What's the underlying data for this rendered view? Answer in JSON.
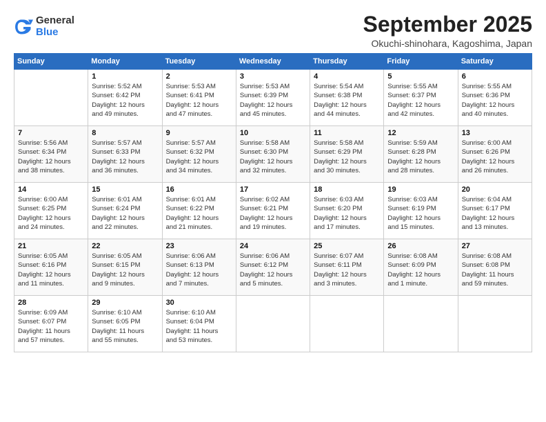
{
  "logo": {
    "general": "General",
    "blue": "Blue"
  },
  "title": "September 2025",
  "subtitle": "Okuchi-shinohara, Kagoshima, Japan",
  "headers": [
    "Sunday",
    "Monday",
    "Tuesday",
    "Wednesday",
    "Thursday",
    "Friday",
    "Saturday"
  ],
  "weeks": [
    [
      {
        "day": "",
        "info": ""
      },
      {
        "day": "1",
        "info": "Sunrise: 5:52 AM\nSunset: 6:42 PM\nDaylight: 12 hours\nand 49 minutes."
      },
      {
        "day": "2",
        "info": "Sunrise: 5:53 AM\nSunset: 6:41 PM\nDaylight: 12 hours\nand 47 minutes."
      },
      {
        "day": "3",
        "info": "Sunrise: 5:53 AM\nSunset: 6:39 PM\nDaylight: 12 hours\nand 45 minutes."
      },
      {
        "day": "4",
        "info": "Sunrise: 5:54 AM\nSunset: 6:38 PM\nDaylight: 12 hours\nand 44 minutes."
      },
      {
        "day": "5",
        "info": "Sunrise: 5:55 AM\nSunset: 6:37 PM\nDaylight: 12 hours\nand 42 minutes."
      },
      {
        "day": "6",
        "info": "Sunrise: 5:55 AM\nSunset: 6:36 PM\nDaylight: 12 hours\nand 40 minutes."
      }
    ],
    [
      {
        "day": "7",
        "info": "Sunrise: 5:56 AM\nSunset: 6:34 PM\nDaylight: 12 hours\nand 38 minutes."
      },
      {
        "day": "8",
        "info": "Sunrise: 5:57 AM\nSunset: 6:33 PM\nDaylight: 12 hours\nand 36 minutes."
      },
      {
        "day": "9",
        "info": "Sunrise: 5:57 AM\nSunset: 6:32 PM\nDaylight: 12 hours\nand 34 minutes."
      },
      {
        "day": "10",
        "info": "Sunrise: 5:58 AM\nSunset: 6:30 PM\nDaylight: 12 hours\nand 32 minutes."
      },
      {
        "day": "11",
        "info": "Sunrise: 5:58 AM\nSunset: 6:29 PM\nDaylight: 12 hours\nand 30 minutes."
      },
      {
        "day": "12",
        "info": "Sunrise: 5:59 AM\nSunset: 6:28 PM\nDaylight: 12 hours\nand 28 minutes."
      },
      {
        "day": "13",
        "info": "Sunrise: 6:00 AM\nSunset: 6:26 PM\nDaylight: 12 hours\nand 26 minutes."
      }
    ],
    [
      {
        "day": "14",
        "info": "Sunrise: 6:00 AM\nSunset: 6:25 PM\nDaylight: 12 hours\nand 24 minutes."
      },
      {
        "day": "15",
        "info": "Sunrise: 6:01 AM\nSunset: 6:24 PM\nDaylight: 12 hours\nand 22 minutes."
      },
      {
        "day": "16",
        "info": "Sunrise: 6:01 AM\nSunset: 6:22 PM\nDaylight: 12 hours\nand 21 minutes."
      },
      {
        "day": "17",
        "info": "Sunrise: 6:02 AM\nSunset: 6:21 PM\nDaylight: 12 hours\nand 19 minutes."
      },
      {
        "day": "18",
        "info": "Sunrise: 6:03 AM\nSunset: 6:20 PM\nDaylight: 12 hours\nand 17 minutes."
      },
      {
        "day": "19",
        "info": "Sunrise: 6:03 AM\nSunset: 6:19 PM\nDaylight: 12 hours\nand 15 minutes."
      },
      {
        "day": "20",
        "info": "Sunrise: 6:04 AM\nSunset: 6:17 PM\nDaylight: 12 hours\nand 13 minutes."
      }
    ],
    [
      {
        "day": "21",
        "info": "Sunrise: 6:05 AM\nSunset: 6:16 PM\nDaylight: 12 hours\nand 11 minutes."
      },
      {
        "day": "22",
        "info": "Sunrise: 6:05 AM\nSunset: 6:15 PM\nDaylight: 12 hours\nand 9 minutes."
      },
      {
        "day": "23",
        "info": "Sunrise: 6:06 AM\nSunset: 6:13 PM\nDaylight: 12 hours\nand 7 minutes."
      },
      {
        "day": "24",
        "info": "Sunrise: 6:06 AM\nSunset: 6:12 PM\nDaylight: 12 hours\nand 5 minutes."
      },
      {
        "day": "25",
        "info": "Sunrise: 6:07 AM\nSunset: 6:11 PM\nDaylight: 12 hours\nand 3 minutes."
      },
      {
        "day": "26",
        "info": "Sunrise: 6:08 AM\nSunset: 6:09 PM\nDaylight: 12 hours\nand 1 minute."
      },
      {
        "day": "27",
        "info": "Sunrise: 6:08 AM\nSunset: 6:08 PM\nDaylight: 11 hours\nand 59 minutes."
      }
    ],
    [
      {
        "day": "28",
        "info": "Sunrise: 6:09 AM\nSunset: 6:07 PM\nDaylight: 11 hours\nand 57 minutes."
      },
      {
        "day": "29",
        "info": "Sunrise: 6:10 AM\nSunset: 6:05 PM\nDaylight: 11 hours\nand 55 minutes."
      },
      {
        "day": "30",
        "info": "Sunrise: 6:10 AM\nSunset: 6:04 PM\nDaylight: 11 hours\nand 53 minutes."
      },
      {
        "day": "",
        "info": ""
      },
      {
        "day": "",
        "info": ""
      },
      {
        "day": "",
        "info": ""
      },
      {
        "day": "",
        "info": ""
      }
    ]
  ]
}
